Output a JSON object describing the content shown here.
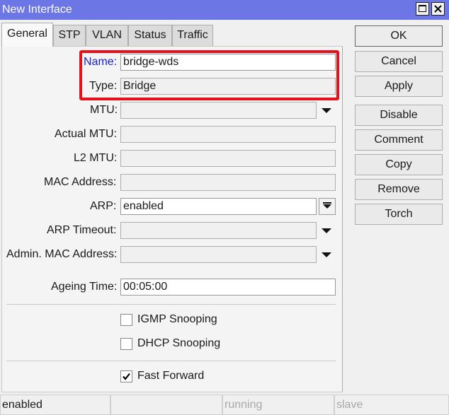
{
  "window": {
    "title": "New Interface"
  },
  "tabs": [
    "General",
    "STP",
    "VLAN",
    "Status",
    "Traffic"
  ],
  "fields": {
    "name": {
      "label": "Name:",
      "value": "bridge-wds"
    },
    "type": {
      "label": "Type:",
      "value": "Bridge"
    },
    "mtu": {
      "label": "MTU:",
      "value": ""
    },
    "actual_mtu": {
      "label": "Actual MTU:",
      "value": ""
    },
    "l2_mtu": {
      "label": "L2 MTU:",
      "value": ""
    },
    "mac_address": {
      "label": "MAC Address:",
      "value": ""
    },
    "arp": {
      "label": "ARP:",
      "value": "enabled"
    },
    "arp_timeout": {
      "label": "ARP Timeout:",
      "value": ""
    },
    "admin_mac": {
      "label": "Admin. MAC Address:",
      "value": ""
    },
    "ageing_time": {
      "label": "Ageing Time:",
      "value": "00:05:00"
    }
  },
  "checkboxes": {
    "igmp": {
      "label": "IGMP Snooping",
      "checked": false
    },
    "dhcp": {
      "label": "DHCP Snooping",
      "checked": false
    },
    "fast_forward": {
      "label": "Fast Forward",
      "checked": true
    }
  },
  "buttons": {
    "ok": "OK",
    "cancel": "Cancel",
    "apply": "Apply",
    "disable": "Disable",
    "comment": "Comment",
    "copy": "Copy",
    "remove": "Remove",
    "torch": "Torch"
  },
  "status": {
    "state": "enabled",
    "running": "running",
    "slave": "slave"
  },
  "colors": {
    "titlebar": "#6c76e4",
    "highlight": "#e8101a",
    "name_label": "#1a22cc"
  }
}
